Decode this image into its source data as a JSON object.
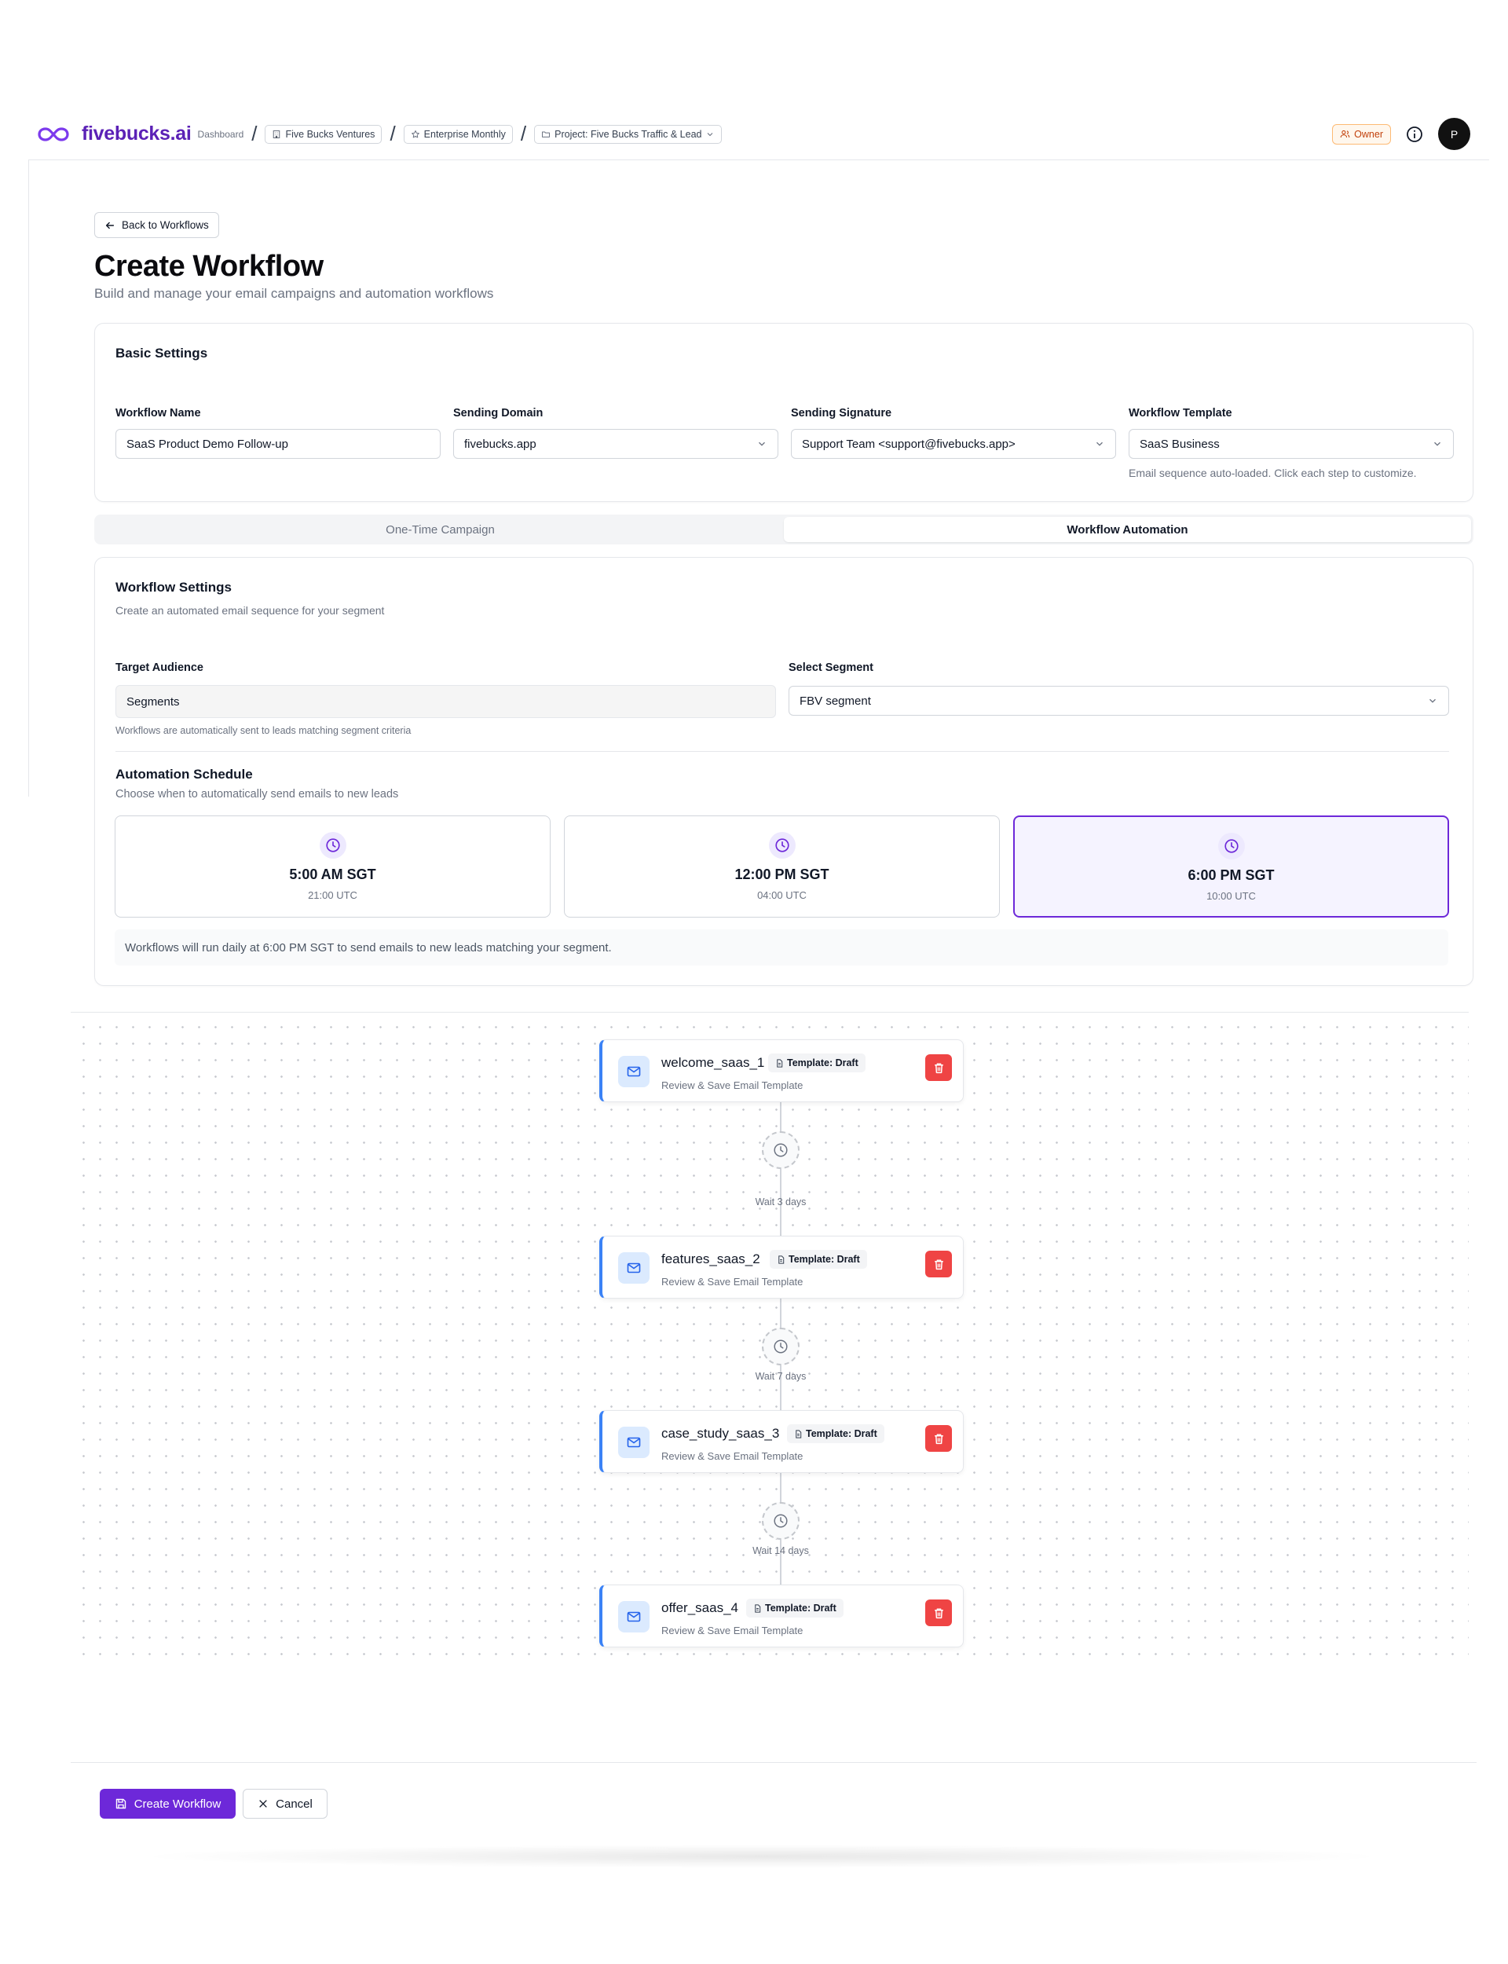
{
  "header": {
    "brand": "fivebucks.ai",
    "dashboard": "Dashboard",
    "separator": "/",
    "breadcrumbs": [
      {
        "label": "Five Bucks Ventures",
        "icon": "building-icon"
      },
      {
        "label": "Enterprise Monthly",
        "icon": "star-icon"
      },
      {
        "label": "Project: Five Bucks Traffic & Lead",
        "icon": "folder-icon"
      }
    ],
    "role_badge": "Owner",
    "avatar_initial": "P"
  },
  "page": {
    "back_label": "Back to Workflows",
    "title": "Create Workflow",
    "subtitle": "Build and manage your email campaigns and automation workflows"
  },
  "basic_settings": {
    "title": "Basic Settings",
    "workflow_name": {
      "label": "Workflow Name",
      "value": "SaaS Product Demo Follow-up"
    },
    "sending_domain": {
      "label": "Sending Domain",
      "value": "fivebucks.app"
    },
    "sending_signature": {
      "label": "Sending Signature",
      "value": "Support Team <support@fivebucks.app>"
    },
    "workflow_template": {
      "label": "Workflow Template",
      "value": "SaaS Business",
      "hint": "Email sequence auto-loaded. Click each step to customize."
    }
  },
  "tabs": [
    {
      "label": "One-Time Campaign",
      "active": false
    },
    {
      "label": "Workflow Automation",
      "active": true
    }
  ],
  "workflow_settings": {
    "title": "Workflow Settings",
    "subtitle": "Create an automated email sequence for your segment",
    "target_audience": {
      "label": "Target Audience",
      "value": "Segments",
      "hint": "Workflows are automatically sent to leads matching segment criteria"
    },
    "select_segment": {
      "label": "Select Segment",
      "value": "FBV segment"
    },
    "schedule": {
      "title": "Automation Schedule",
      "subtitle": "Choose when to automatically send emails to new leads",
      "options": [
        {
          "time": "5:00 AM SGT",
          "utc": "21:00 UTC",
          "selected": false
        },
        {
          "time": "12:00 PM SGT",
          "utc": "04:00 UTC",
          "selected": false
        },
        {
          "time": "6:00 PM SGT",
          "utc": "10:00 UTC",
          "selected": true
        }
      ],
      "note": "Workflows will run daily at 6:00 PM SGT to send emails to new leads matching your segment."
    }
  },
  "steps": [
    {
      "name": "welcome_saas_1",
      "badge": "Template: Draft",
      "subtitle": "Review & Save Email Template"
    },
    {
      "name": "features_saas_2",
      "badge": "Template: Draft",
      "subtitle": "Review & Save Email Template"
    },
    {
      "name": "case_study_saas_3",
      "badge": "Template: Draft",
      "subtitle": "Review & Save Email Template"
    },
    {
      "name": "offer_saas_4",
      "badge": "Template: Draft",
      "subtitle": "Review & Save Email Template"
    }
  ],
  "waits": [
    "Wait 3 days",
    "Wait 7 days",
    "Wait 14 days"
  ],
  "footer": {
    "create_label": "Create Workflow",
    "cancel_label": "Cancel"
  },
  "colors": {
    "brand": "#5b21b6",
    "primary": "#6d28d9",
    "step_accent": "#3b82f6",
    "danger": "#ef4444",
    "owner_badge": "#c2410c"
  }
}
